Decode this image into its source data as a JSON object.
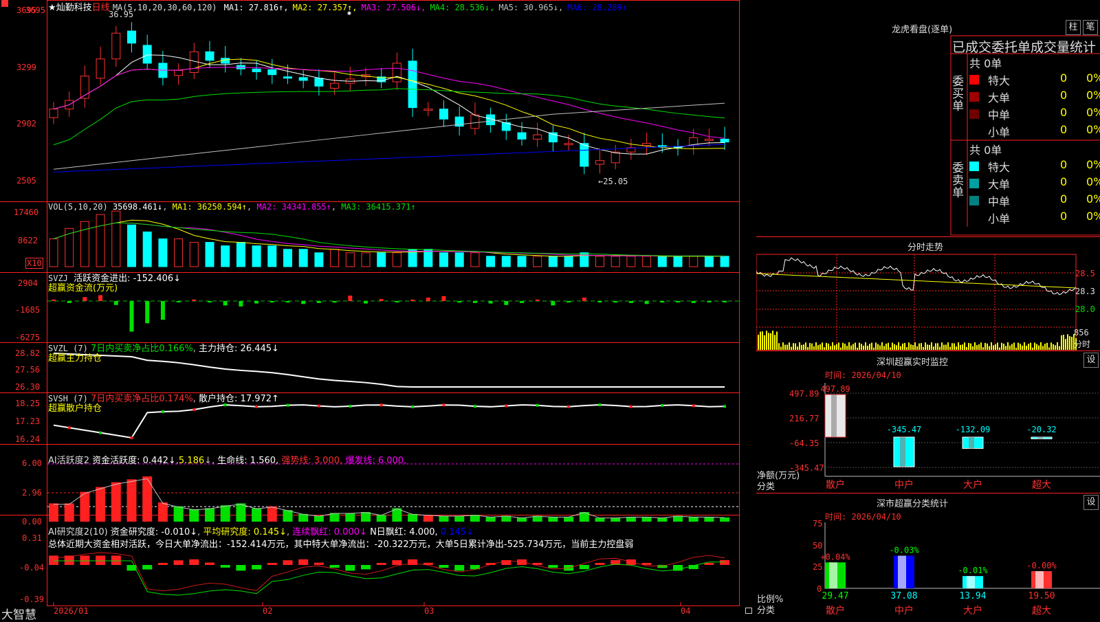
{
  "app": {
    "brand": "大智慧",
    "stock_title": "★灿勤科技",
    "period_label": "日线"
  },
  "main_chart": {
    "ma_legend": "MA(5,10,20,30,60,120)",
    "ma_items": [
      {
        "label": "MA1: 27.816↑",
        "color": "#ffffff"
      },
      {
        "label": "MA2: 27.357↑",
        "color": "#ffff00"
      },
      {
        "label": "MA3: 27.506↓",
        "color": "#ff00ff"
      },
      {
        "label": "MA4: 28.536↓",
        "color": "#00e000"
      },
      {
        "label": "MA5: 30.965↓",
        "color": "#c0c0c0"
      },
      {
        "label": "MA6: 28.289↑",
        "color": "#0000ff"
      }
    ],
    "y_ticks": [
      "3695",
      "3299",
      "2902",
      "2505"
    ],
    "high_label": "36.95",
    "low_label": "←25.05"
  },
  "vol_panel": {
    "legend": "VOL(5,10,20)",
    "value": "35698.461↓",
    "ma1": "MA1: 36250.594↑",
    "ma2": "MA2: 34341.855↑",
    "ma3": "MA3: 36415.371↑",
    "y_ticks": [
      "17460",
      "8622"
    ],
    "unit": "X10"
  },
  "svzj_panel": {
    "legend": "SVZJ",
    "desc": "活跃资金进出: -152.406↓",
    "sub": "超赢资金流(万元)",
    "y_ticks": [
      "2904",
      "-1685",
      "-6275"
    ]
  },
  "svzl_panel": {
    "legend": "SVZL (7)",
    "desc": "7日内买卖净占比0.166%",
    "holding": "主力持仓: 26.445↓",
    "sub": "超赢主力持仓",
    "y_ticks": [
      "28.82",
      "27.56",
      "26.30"
    ]
  },
  "svsh_panel": {
    "legend": "SVSH (7)",
    "desc": "7日内买卖净占比0.174%",
    "holding": "散户持仓: 17.972↑",
    "sub": "超赢散户持仓",
    "y_ticks": [
      "18.25",
      "17.23",
      "16.24"
    ]
  },
  "ai_active": {
    "legend": "AI活跃度2",
    "a": "资金活跃度: 0.442↓",
    "b": "5.186",
    "c": "生命线: 1.560,",
    "d": "强势线: 3.000,",
    "e": "爆发线: 6.000,",
    "y_ticks": [
      "6.00",
      "2.96",
      "0.00"
    ]
  },
  "ai_research": {
    "legend": "AI研究度2(10)",
    "a": "资金研究度: -0.010↓",
    "b": "平均研究度: 0.145↓",
    "c": "连续飘红: 0.000↓",
    "d": "N日飘红: 4.000,",
    "e": "0.145↓",
    "summary": "总体近期大资金相对活跃，今日大单净流出：-152.414万元，其中特大单净流出：-20.322万元，大单5日累计净出-525.734万元，当前主力控盘弱",
    "y_ticks": [
      "0.31",
      "-0.04",
      "-0.39"
    ]
  },
  "x_axis": [
    "2026/01",
    "02",
    "03",
    "04"
  ],
  "right": {
    "lhb_title": "龙虎看盘(逐单)",
    "btn_col": "柱",
    "btn_pen": "笔",
    "table_title": "已成交委托单成交量统计",
    "buy_label": "委买单",
    "sell_label": "委卖单",
    "buy_total": "共 0单",
    "sell_total": "共 0单",
    "rows": [
      {
        "name": "特大",
        "count": "0",
        "pct": "0%"
      },
      {
        "name": "大单",
        "count": "0",
        "pct": "0%"
      },
      {
        "name": "中单",
        "count": "0",
        "pct": "0%"
      },
      {
        "name": "小单",
        "count": "0",
        "pct": "0%"
      }
    ],
    "intraday_title": "分时走势",
    "intraday_prices": [
      "28.5",
      "28.3",
      "28.0"
    ],
    "intraday_vol": "856",
    "intraday_unit": "分时",
    "sz_title": "深圳超赢实时监控",
    "sz_btn": "设",
    "sz_time": "时间: 2026/04/10",
    "sz_y": [
      "497.89",
      "216.77",
      "-64.35",
      "-345.47"
    ],
    "sz_yname1": "净额(万元)",
    "sz_yname2": "分类",
    "cat_labels": [
      "散户",
      "中户",
      "大户",
      "超大"
    ],
    "cls_title": "深市超赢分类统计",
    "cls_btn": "设",
    "cls_time": "时间: 2026/04/10",
    "cls_y": [
      "75",
      "50",
      "25",
      "0"
    ],
    "cls_yname1": "比例%",
    "cls_yname2": "分类"
  },
  "chart_data": [
    {
      "type": "candlestick",
      "title": "★灿勤科技 日线",
      "ylim": [
        25.05,
        36.95
      ],
      "values": [
        30.2,
        30.8,
        32.5,
        33.7,
        35.5,
        34.8,
        33.4,
        32.4,
        32.9,
        34.2,
        33.6,
        33.4,
        33.0,
        32.8,
        32.6,
        32.4,
        32.2,
        31.8,
        32.0,
        32.3,
        32.6,
        32.1,
        33.4,
        30.3,
        30.2,
        29.5,
        29.0,
        29.8,
        29.1,
        28.7,
        28.1,
        28.4,
        27.9,
        27.8,
        26.2,
        26.6,
        27.2,
        27.5,
        27.8,
        27.6,
        27.5,
        28.2,
        28.1,
        27.9
      ],
      "labels": [
        "36.95",
        "25.05"
      ]
    },
    {
      "type": "bar",
      "title": "VOL(5,10,20)",
      "values": [
        8,
        11,
        13,
        15,
        16,
        12,
        10,
        8,
        8,
        7,
        7,
        6,
        7,
        6,
        6,
        5,
        5,
        4,
        5,
        4,
        4,
        4,
        4,
        5,
        5,
        4,
        4,
        4,
        3,
        3,
        3,
        3,
        3,
        3,
        4,
        3,
        3,
        3,
        3,
        3,
        3,
        3,
        3,
        3
      ]
    },
    {
      "type": "bar",
      "title": "超赢资金流(万元)",
      "values": [
        300,
        -400,
        800,
        1200,
        -800,
        -6200,
        -4500,
        -3800,
        -200,
        300,
        -200,
        -900,
        -1100,
        -500,
        -200,
        -300,
        -600,
        -400,
        -300,
        1100,
        -500,
        400,
        -200,
        300,
        700,
        1000,
        -300,
        -400,
        -500,
        -800,
        -400,
        300,
        -900,
        -300,
        700,
        -200,
        -300,
        -400,
        -600,
        -300,
        -200,
        -400,
        -100,
        -152
      ]
    },
    {
      "type": "bar",
      "title": "AI活跃度2",
      "values": [
        1.9,
        1.9,
        3.1,
        3.6,
        4.1,
        4.4,
        4.7,
        2.0,
        1.6,
        1.3,
        1.4,
        1.7,
        1.9,
        1.4,
        1.6,
        1.2,
        0.8,
        0.6,
        0.9,
        0.9,
        1.0,
        0.7,
        1.4,
        0.8,
        0.7,
        0.6,
        0.6,
        0.7,
        0.5,
        0.6,
        0.4,
        0.6,
        0.5,
        0.5,
        1.0,
        0.4,
        0.4,
        0.5,
        0.5,
        0.4,
        0.6,
        0.5,
        0.5,
        0.44
      ]
    },
    {
      "type": "bar",
      "title": "深圳超赢实时监控",
      "categories": [
        "散户",
        "中户",
        "大户",
        "超大"
      ],
      "values": [
        497.89,
        -345.47,
        -132.09,
        -20.32
      ]
    },
    {
      "type": "bar",
      "title": "深市超赢分类统计",
      "categories": [
        "散户",
        "中户",
        "大户",
        "超大"
      ],
      "values": [
        29.47,
        37.08,
        13.94,
        19.5
      ],
      "changes": [
        "+0.04%",
        "-0.03%",
        "-0.01%",
        "-0.00%"
      ]
    }
  ]
}
